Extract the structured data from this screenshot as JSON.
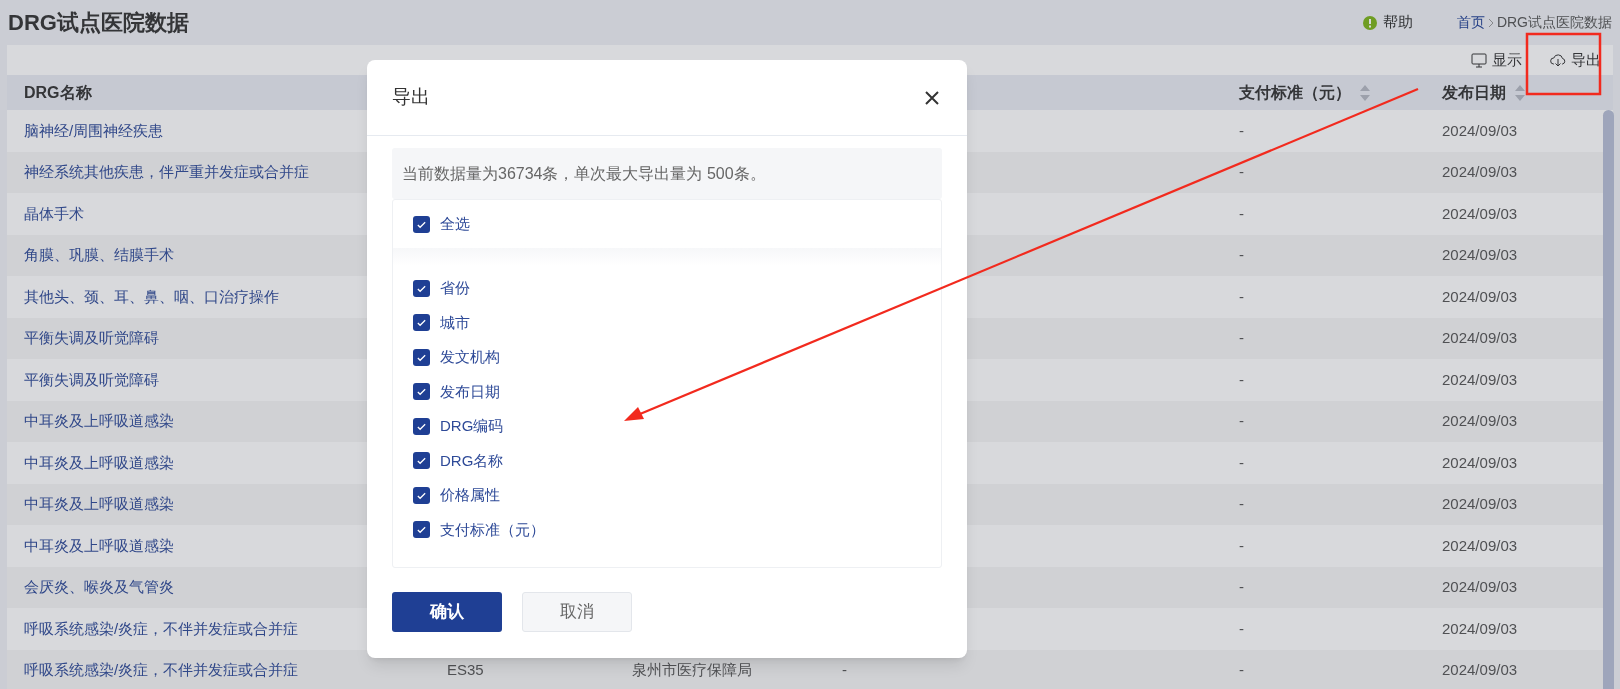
{
  "page": {
    "title": "DRG试点医院数据",
    "help": "帮助",
    "breadcrumb": [
      "首页",
      "DRG试点医院数据"
    ]
  },
  "toolbar": [
    {
      "kind": "display",
      "label": "显示"
    },
    {
      "kind": "export",
      "label": "导出"
    }
  ],
  "table": {
    "columns": [
      {
        "label": "DRG名称",
        "sortable": false
      },
      {
        "label": "支付标准（元）",
        "sortable": true
      },
      {
        "label": "发布日期",
        "sortable": true
      }
    ],
    "rows": [
      {
        "name": "脑神经/周围神经疾患",
        "payment": "-",
        "date": "2024/09/03"
      },
      {
        "name": "神经系统其他疾患，伴严重并发症或合并症",
        "payment": "-",
        "date": "2024/09/03"
      },
      {
        "name": "晶体手术",
        "payment": "-",
        "date": "2024/09/03"
      },
      {
        "name": "角膜、巩膜、结膜手术",
        "payment": "-",
        "date": "2024/09/03"
      },
      {
        "name": "其他头、颈、耳、鼻、咽、口治疗操作",
        "payment": "-",
        "date": "2024/09/03"
      },
      {
        "name": "平衡失调及听觉障碍",
        "payment": "-",
        "date": "2024/09/03"
      },
      {
        "name": "平衡失调及听觉障碍",
        "payment": "-",
        "date": "2024/09/03"
      },
      {
        "name": "中耳炎及上呼吸道感染",
        "payment": "-",
        "date": "2024/09/03"
      },
      {
        "name": "中耳炎及上呼吸道感染",
        "payment": "-",
        "date": "2024/09/03"
      },
      {
        "name": "中耳炎及上呼吸道感染",
        "payment": "-",
        "date": "2024/09/03"
      },
      {
        "name": "中耳炎及上呼吸道感染",
        "payment": "-",
        "date": "2024/09/03"
      },
      {
        "name": "会厌炎、喉炎及气管炎",
        "payment": "-",
        "date": "2024/09/03"
      },
      {
        "name": "呼吸系统感染/炎症，不伴并发症或合并症",
        "payment": "-",
        "date": "2024/09/03"
      },
      {
        "name": "呼吸系统感染/炎症，不伴并发症或合并症",
        "code": "ES35",
        "agency": "泉州市医疗保障局",
        "column_4": "-",
        "payment": "-",
        "date": "2024/09/03"
      }
    ]
  },
  "dialog": {
    "title": "导出",
    "notice": "当前数据量为36734条，单次最大导出量为 500条。",
    "select_all": {
      "label": "全选",
      "checked": true
    },
    "fields": [
      {
        "label": "省份",
        "checked": true
      },
      {
        "label": "城市",
        "checked": true
      },
      {
        "label": "发文机构",
        "checked": true
      },
      {
        "label": "发布日期",
        "checked": true
      },
      {
        "label": "DRG编码",
        "checked": true
      },
      {
        "label": "DRG名称",
        "checked": true
      },
      {
        "label": "价格属性",
        "checked": true
      },
      {
        "label": "支付标准（元）",
        "checked": true
      }
    ],
    "buttons": [
      {
        "kind": "primary",
        "label": "确认"
      },
      {
        "kind": "secondary",
        "label": "取消"
      }
    ]
  }
}
